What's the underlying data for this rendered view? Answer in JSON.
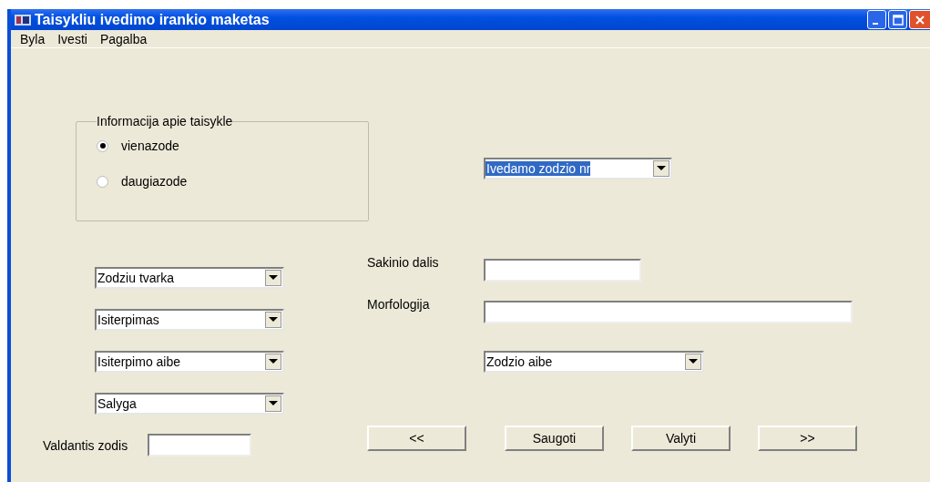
{
  "window": {
    "title": "Taisykliu ivedimo irankio maketas"
  },
  "menu": [
    "Byla",
    "Ivesti",
    "Pagalba"
  ],
  "rule_info": {
    "legend": "Informacija apie taisykle",
    "options": [
      {
        "label": "vienazode",
        "selected": true
      },
      {
        "label": "daugiazode",
        "selected": false
      }
    ]
  },
  "left_dropdowns": [
    {
      "value": "Zodziu tvarka"
    },
    {
      "value": "Isiterpimas"
    },
    {
      "value": "Isiterpimo aibe"
    },
    {
      "value": "Salyga"
    }
  ],
  "governing_word": {
    "label": "Valdantis zodis"
  },
  "word_number": {
    "value": "Ivedamo zodzio nr",
    "text_selected": true
  },
  "fields": [
    {
      "label": "Sakinio dalis",
      "wide": false
    },
    {
      "label": "Morfologija",
      "wide": true
    }
  ],
  "word_set": {
    "value": "Zodzio aibe"
  },
  "buttons": [
    "<<",
    "Saugoti",
    "Valyti",
    ">>"
  ]
}
